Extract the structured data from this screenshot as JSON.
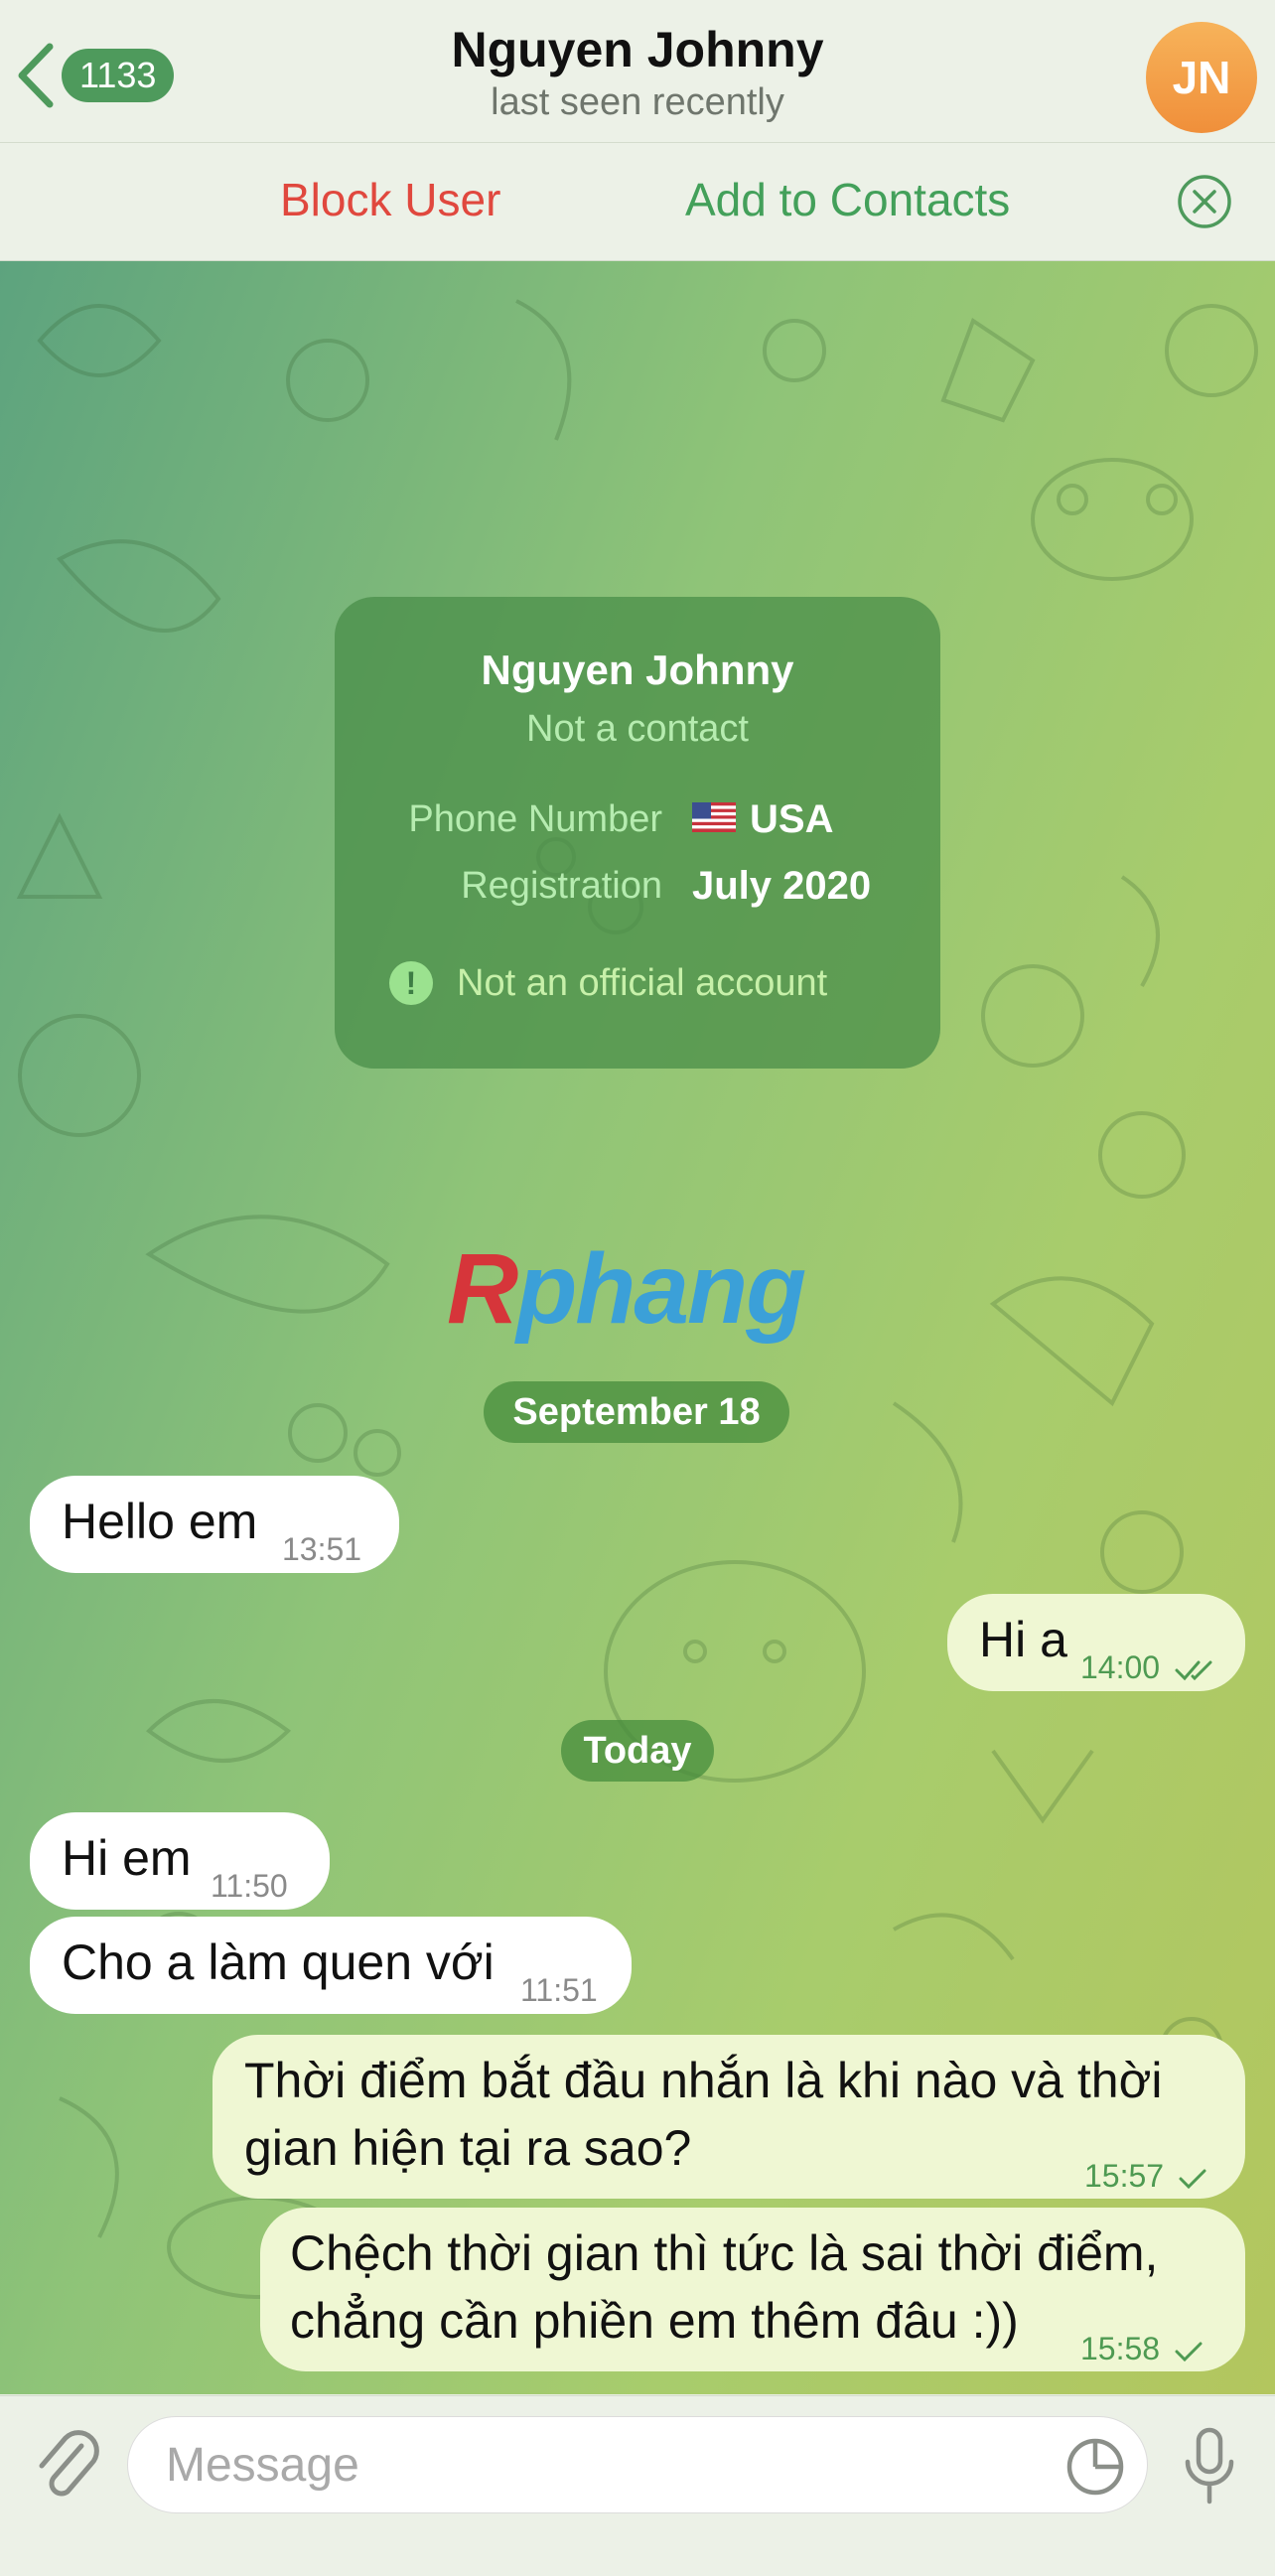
{
  "header": {
    "back_count": "1133",
    "title": "Nguyen Johnny",
    "subtitle": "last seen recently",
    "avatar_initials": "JN"
  },
  "actions": {
    "block_label": "Block User",
    "add_label": "Add to Contacts"
  },
  "info_card": {
    "name": "Nguyen Johnny",
    "status": "Not a contact",
    "phone_label": "Phone Number",
    "phone_value": "USA",
    "registration_label": "Registration",
    "registration_value": "July 2020",
    "warning": "Not an official account"
  },
  "watermark": {
    "first": "R",
    "rest": "phang"
  },
  "dates": {
    "first": "September 18",
    "second": "Today"
  },
  "messages": [
    {
      "direction": "in",
      "text": "Hello em",
      "time": "13:51"
    },
    {
      "direction": "out",
      "text": "Hi a",
      "time": "14:00",
      "status": "read"
    },
    {
      "direction": "in",
      "text": "Hi em",
      "time": "11:50"
    },
    {
      "direction": "in",
      "text": "Cho a làm quen với",
      "time": "11:51"
    },
    {
      "direction": "out",
      "line1": "Thời điểm bắt đầu nhắn là khi nào và thời",
      "line2": "gian hiện tại ra sao?",
      "time": "15:57",
      "status": "sent"
    },
    {
      "direction": "out",
      "line1": "Chệch thời gian thì tức là sai thời điểm,",
      "line2": "chẳng cần phiền em thêm đâu :))",
      "time": "15:58",
      "status": "sent"
    }
  ],
  "composer": {
    "placeholder": "Message"
  },
  "colors": {
    "accent_green": "#4e9a5c",
    "block_red": "#e0483e",
    "avatar_orange": "#f4a44a",
    "outgoing_bubble": "#eff7d3"
  },
  "icons": [
    "chevron-left-icon",
    "close-circle-icon",
    "alert-icon",
    "paperclip-icon",
    "sticker-icon",
    "microphone-icon",
    "double-check-icon",
    "check-icon",
    "us-flag-icon"
  ]
}
